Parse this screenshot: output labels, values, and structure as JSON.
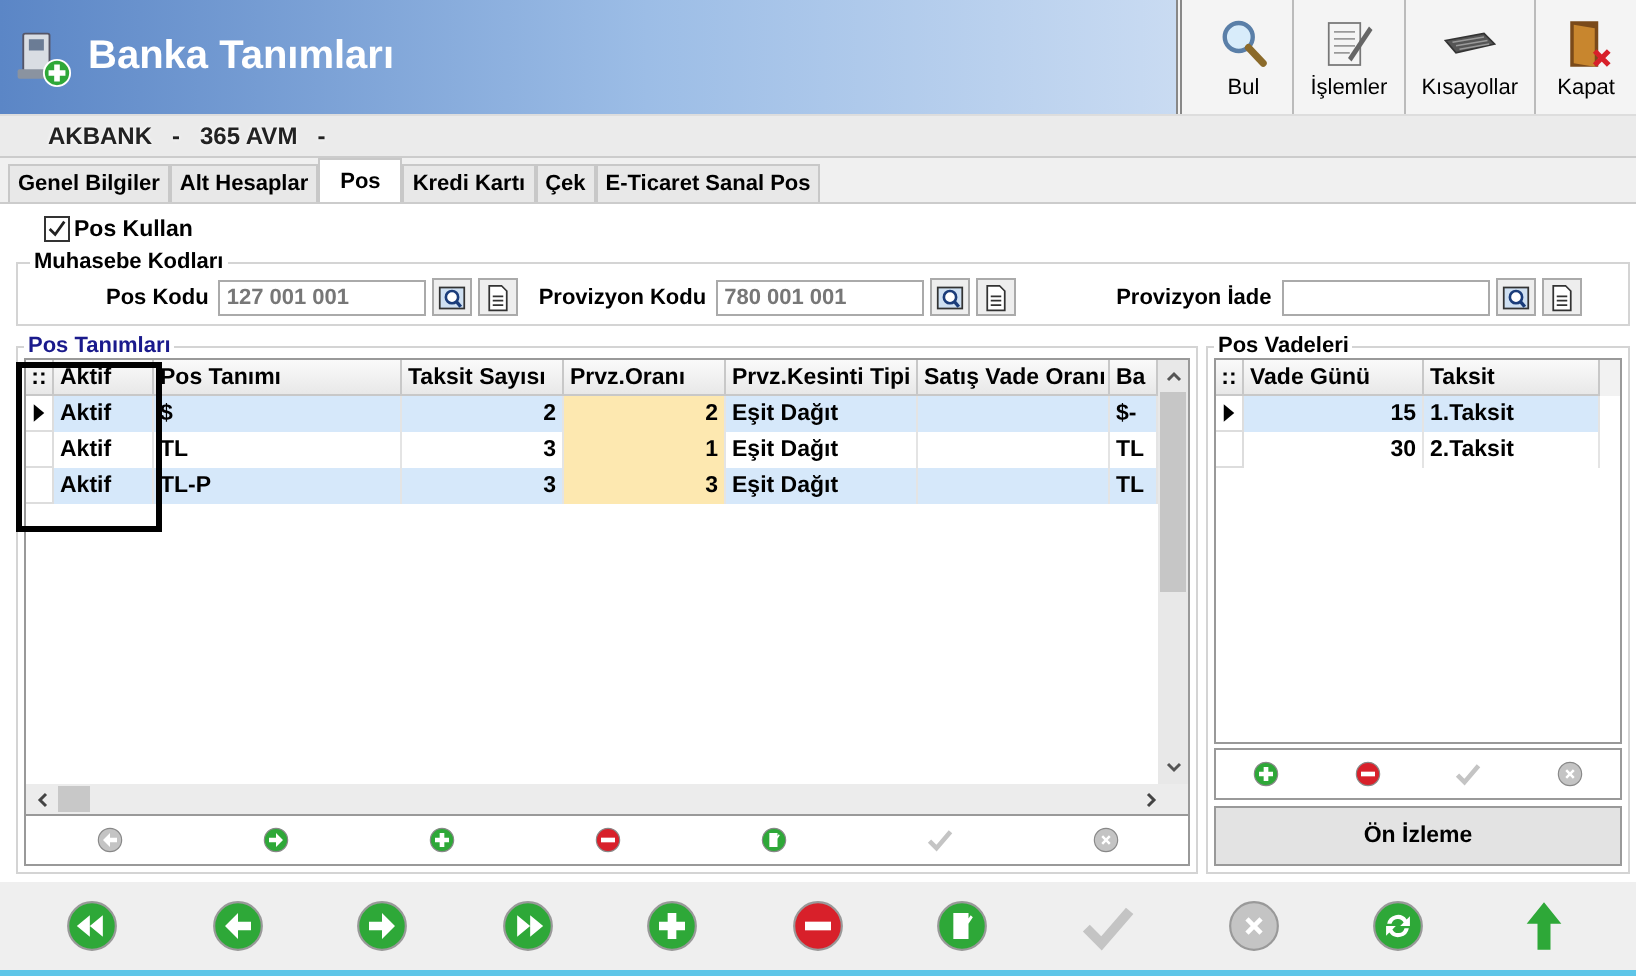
{
  "window": {
    "title": "Banka Tanımları"
  },
  "toolbar": [
    {
      "label": "Bul",
      "kind": "search"
    },
    {
      "label": "İşlemler",
      "kind": "document"
    },
    {
      "label": "Kısayollar",
      "kind": "keyboard"
    },
    {
      "label": "Kapat",
      "kind": "exit"
    }
  ],
  "record": {
    "bank": "AKBANK",
    "separator_1": "-",
    "branch": "365 AVM",
    "separator_2": "-"
  },
  "tabs": [
    {
      "label": "Genel Bilgiler",
      "selected": false
    },
    {
      "label": "Alt Hesaplar",
      "selected": false
    },
    {
      "label": "Pos",
      "selected": true
    },
    {
      "label": "Kredi Kartı",
      "selected": false
    },
    {
      "label": "Çek",
      "selected": false
    },
    {
      "label": "E-Ticaret Sanal Pos",
      "selected": false
    }
  ],
  "pos_kullan": {
    "label": "Pos Kullan",
    "checked": true
  },
  "muhasebe_kodlari": {
    "title": "Muhasebe Kodları",
    "fields": [
      {
        "label": "Pos Kodu",
        "value": "127 001 001"
      },
      {
        "label": "Provizyon Kodu",
        "value": "780 001 001"
      },
      {
        "label": "Provizyon İade"
      }
    ]
  },
  "pos_tanimlari": {
    "title": "Pos Tanımları",
    "grip": "::",
    "columns": [
      "Aktif",
      "Pos Tanımı",
      "Taksit Sayısı",
      "Prvz.Oranı",
      "Prvz.Kesinti Tipi",
      "Satış Vade Oranı",
      "Ba"
    ],
    "rows": [
      {
        "selected": true,
        "aktif": "Aktif",
        "pos_tanimi": "$",
        "taksit_sayisi": "2",
        "prvz_orani": "2",
        "prvz_kesinti_tipi": "Eşit Dağıt",
        "column_7": "$-"
      },
      {
        "selected": false,
        "aktif": "Aktif",
        "pos_tanimi": "TL",
        "taksit_sayisi": "3",
        "prvz_orani": "1",
        "prvz_kesinti_tipi": "Eşit Dağıt",
        "column_7": "TL"
      },
      {
        "selected": false,
        "aktif": "Aktif",
        "pos_tanimi": "TL-P",
        "taksit_sayisi": "3",
        "prvz_orani": "3",
        "prvz_kesinti_tipi": "Eşit Dağıt",
        "column_7": "TL"
      }
    ],
    "toolbar": [
      {
        "kind": "prev",
        "disabled": true
      },
      {
        "kind": "next",
        "disabled": false
      },
      {
        "kind": "add",
        "disabled": false
      },
      {
        "kind": "delete",
        "disabled": false
      },
      {
        "kind": "edit",
        "disabled": false
      },
      {
        "kind": "confirm",
        "disabled": true
      },
      {
        "kind": "cancel",
        "disabled": true
      }
    ]
  },
  "pos_vadeleri": {
    "title": "Pos Vadeleri",
    "grip": "::",
    "columns": [
      "Vade Günü",
      "Taksit"
    ],
    "rows": [
      {
        "selected": true,
        "vade_gunu": "15",
        "taksit": "1.Taksit"
      },
      {
        "selected": false,
        "vade_gunu": "30",
        "taksit": "2.Taksit"
      }
    ],
    "toolbar": [
      {
        "kind": "add",
        "disabled": false
      },
      {
        "kind": "delete",
        "disabled": false
      },
      {
        "kind": "confirm",
        "disabled": true
      },
      {
        "kind": "cancel",
        "disabled": true
      }
    ],
    "preview_button": "Ön İzleme"
  },
  "navigation": [
    {
      "kind": "first",
      "disabled": false
    },
    {
      "kind": "prev",
      "disabled": false
    },
    {
      "kind": "next",
      "disabled": false
    },
    {
      "kind": "last",
      "disabled": false
    },
    {
      "kind": "add",
      "disabled": false
    },
    {
      "kind": "delete",
      "disabled": false
    },
    {
      "kind": "edit",
      "disabled": false
    },
    {
      "kind": "confirm",
      "disabled": true
    },
    {
      "kind": "cancel",
      "disabled": true
    },
    {
      "kind": "refresh",
      "disabled": false
    },
    {
      "kind": "up",
      "disabled": false
    }
  ]
}
